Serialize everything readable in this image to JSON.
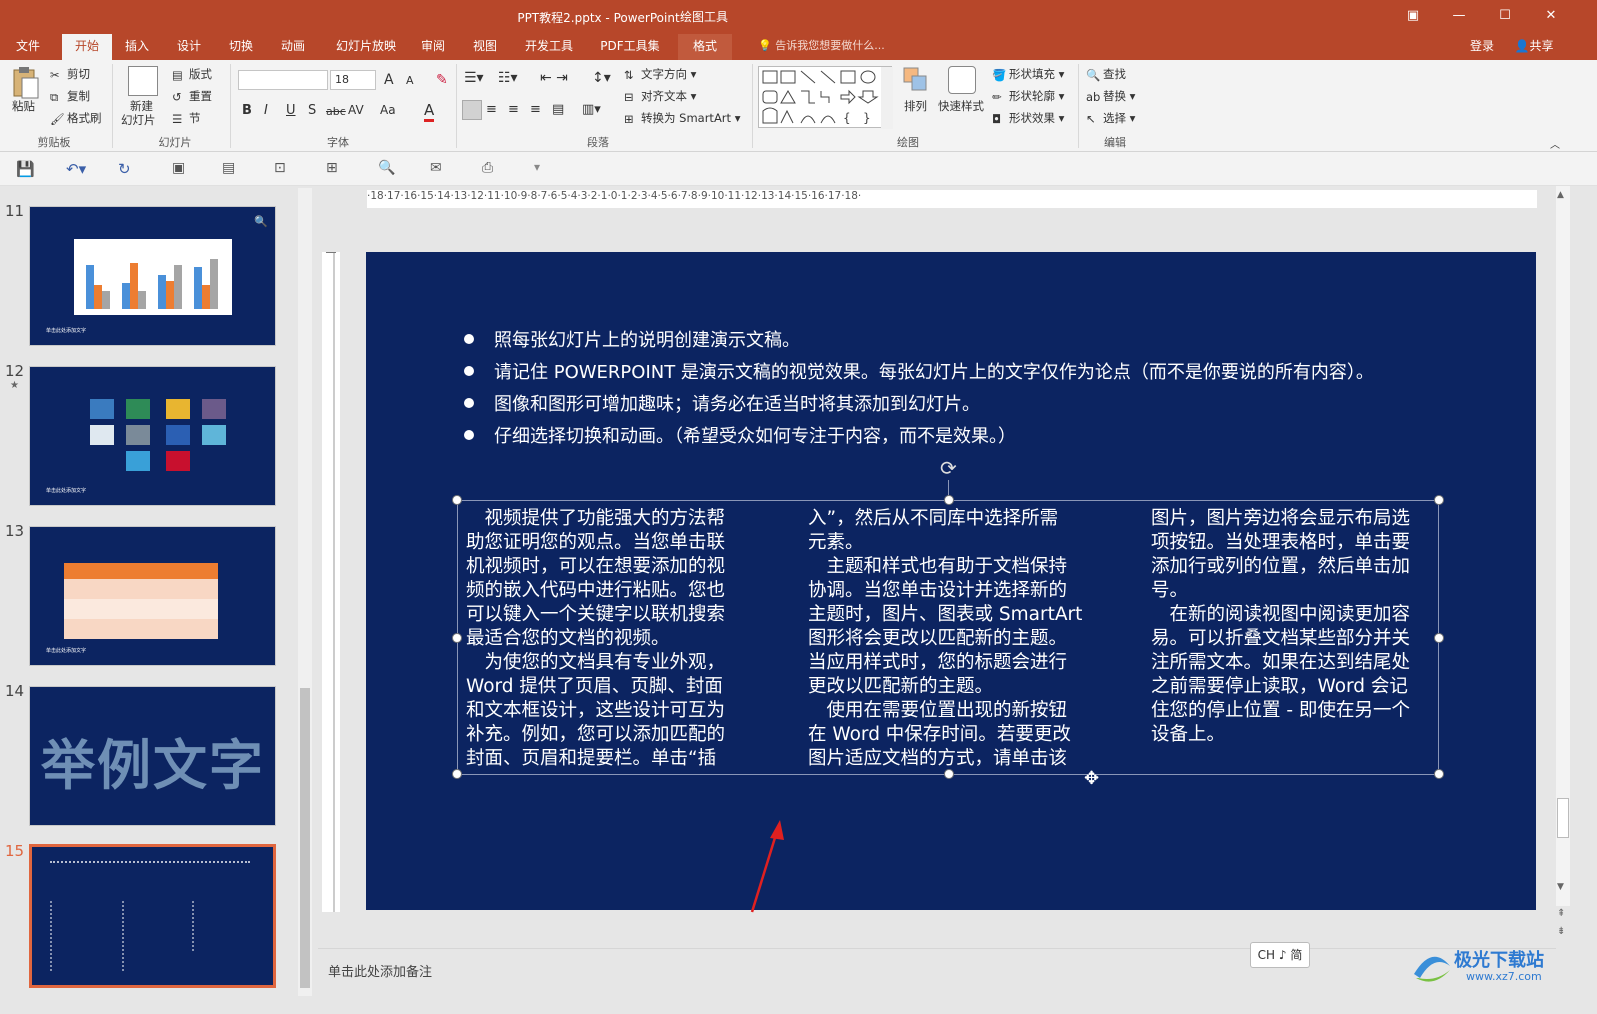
{
  "window": {
    "title": "PPT教程2.pptx - PowerPoint",
    "tool_context": "绘图工具",
    "buttons": {
      "restore_ribbon": "▣",
      "minimize": "—",
      "maximize": "☐",
      "close": "✕"
    }
  },
  "tabs": [
    "文件",
    "开始",
    "插入",
    "设计",
    "切换",
    "动画",
    "幻灯片放映",
    "审阅",
    "视图",
    "开发工具",
    "PDF工具集",
    "格式"
  ],
  "active_tab": "开始",
  "tell_me": "告诉我您想要做什么...",
  "account": {
    "signin": "登录",
    "share": "共享"
  },
  "ribbon": {
    "clipboard": {
      "paste": "粘贴",
      "cut": "剪切",
      "copy": "复制",
      "format_painter": "格式刷",
      "group": "剪贴板"
    },
    "slides": {
      "new_slide": "新建",
      "new_slide2": "幻灯片",
      "layout": "版式",
      "reset": "重置",
      "section": "节",
      "group": "幻灯片"
    },
    "font": {
      "font_name": "",
      "font_size": "18",
      "grow": "A",
      "shrink": "A",
      "bold": "B",
      "italic": "I",
      "underline": "U",
      "shadow": "S",
      "strike": "abc",
      "spacing": "AV",
      "case": "Aa",
      "color": "A",
      "group": "字体"
    },
    "paragraph": {
      "text_direction": "文字方向",
      "align_text": "对齐文本",
      "smartart": "转换为 SmartArt",
      "group": "段落"
    },
    "drawing": {
      "arrange": "排列",
      "quick_styles": "快速样式",
      "shape_fill": "形状填充",
      "shape_outline": "形状轮廓",
      "shape_effects": "形状效果",
      "group": "绘图"
    },
    "editing": {
      "find": "查找",
      "replace": "替换",
      "select": "选择",
      "group": "编辑"
    }
  },
  "slides_panel": {
    "numbers": [
      "11",
      "12",
      "13",
      "14",
      "15"
    ],
    "thumb14_text": "举例文字",
    "thumb_caption": "单击此处添加文字"
  },
  "ruler_labels": "·18·17·16·15·14·13·12·11·10·9·8·7·6·5·4·3·2·1·0·1·2·3·4·5·6·7·8·9·10·11·12·13·14·15·16·17·18·",
  "slide": {
    "bullets": [
      "照每张幻灯片上的说明创建演示文稿。",
      "请记住 POWERPOINT 是演示文稿的视觉效果。每张幻灯片上的文字仅作为论点（而不是你要说的所有内容）。",
      "图像和图形可增加趣味；请务必在适当时将其添加到幻灯片。",
      "仔细选择切换和动画。（希望受众如何专注于内容，而不是效果。）"
    ],
    "columns": [
      [
        "　视频提供了功能强大的方法帮",
        "助您证明您的观点。当您单击联",
        "机视频时，可以在想要添加的视",
        "频的嵌入代码中进行粘贴。您也",
        "可以键入一个关键字以联机搜索",
        "最适合您的文档的视频。",
        "　为使您的文档具有专业外观，",
        "Word 提供了页眉、页脚、封面",
        "和文本框设计，这些设计可互为",
        "补充。例如，您可以添加匹配的",
        "封面、页眉和提要栏。单击“插"
      ],
      [
        "入”，然后从不同库中选择所需",
        "元素。",
        "　主题和样式也有助于文档保持",
        "协调。当您单击设计并选择新的",
        "主题时，图片、图表或 SmartArt",
        "图形将会更改以匹配新的主题。",
        "当应用样式时，您的标题会进行",
        "更改以匹配新的主题。",
        "　使用在需要位置出现的新按钮",
        "在 Word 中保存时间。若要更改",
        "图片适应文档的方式，请单击该"
      ],
      [
        "图片，图片旁边将会显示布局选",
        "项按钮。当处理表格时，单击要",
        "添加行或列的位置，然后单击加",
        "号。",
        "　在新的阅读视图中阅读更加容",
        "易。可以折叠文档某些部分并关",
        "注所需文本。如果在达到结尾处",
        "之前需要停止读取，Word 会记",
        "住您的停止位置 - 即使在另一个",
        "设备上。"
      ]
    ]
  },
  "notes_placeholder": "单击此处添加备注",
  "ime": "CH ♪ 简",
  "watermark": {
    "line1": "极光下载站",
    "line2": "www.xz7.com"
  },
  "colors": {
    "accent": "#b7472a",
    "slide_bg": "#0c2461",
    "annotation_arrow": "#e02020"
  }
}
